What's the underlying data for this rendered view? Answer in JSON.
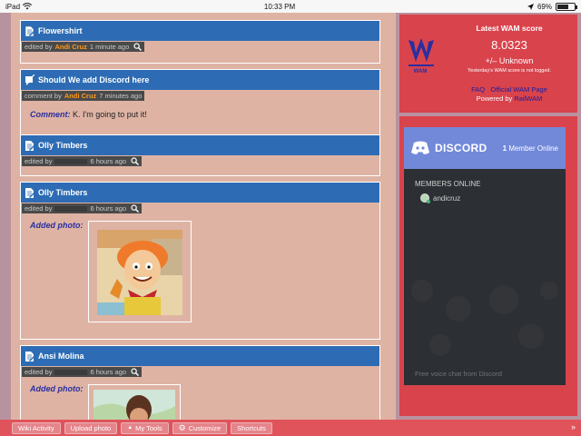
{
  "status_bar": {
    "device": "iPad",
    "time": "10:33 PM",
    "battery": "69%",
    "battery_level": 0.69
  },
  "activity": [
    {
      "title": "Flowershirt",
      "meta_prefix": "edited by",
      "user": "Andi Cruz",
      "time": "1 minute ago"
    },
    {
      "title": "Should We add Discord here",
      "meta_prefix": "comment by",
      "user": "Andi Cruz",
      "time": "7 minutes ago",
      "comment_label": "Comment:",
      "comment_text": "K. I'm going to put it!"
    },
    {
      "title": "Olly Timbers",
      "meta_prefix": "edited by",
      "time": "6 hours ago"
    },
    {
      "title": "Olly Timbers",
      "meta_prefix": "edited by",
      "time": "6 hours ago",
      "photo_label": "Added photo:"
    },
    {
      "title": "Ansi Molina",
      "meta_prefix": "edited by",
      "time": "6 hours ago",
      "photo_label": "Added photo:"
    }
  ],
  "wam": {
    "title": "Latest WAM score",
    "score": "8.0323",
    "change": "+/– Unknown",
    "note": "Yesterday's WAM score is not logged.",
    "faq": "FAQ",
    "official": "Official WAM Page",
    "powered_prefix": "Powered by",
    "powered_link": "RailWAM",
    "logo_text": "WAM"
  },
  "discord": {
    "brand": "DISCORD",
    "online_count": "1",
    "online_label": "Member Online",
    "members_title": "MEMBERS ONLINE",
    "members": [
      "andicruz"
    ],
    "footer": "Free voice chat from Discord"
  },
  "toolbar": {
    "wiki_activity": "Wiki Activity",
    "upload_photo": "Upload photo",
    "my_tools": "My Tools",
    "customize": "Customize",
    "shortcuts": "Shortcuts"
  },
  "colors": {
    "entry_header": "#2d6cb4",
    "rail_red": "#d9434c",
    "discord_blurple": "#7289da",
    "page_bg": "#deb3a4"
  }
}
